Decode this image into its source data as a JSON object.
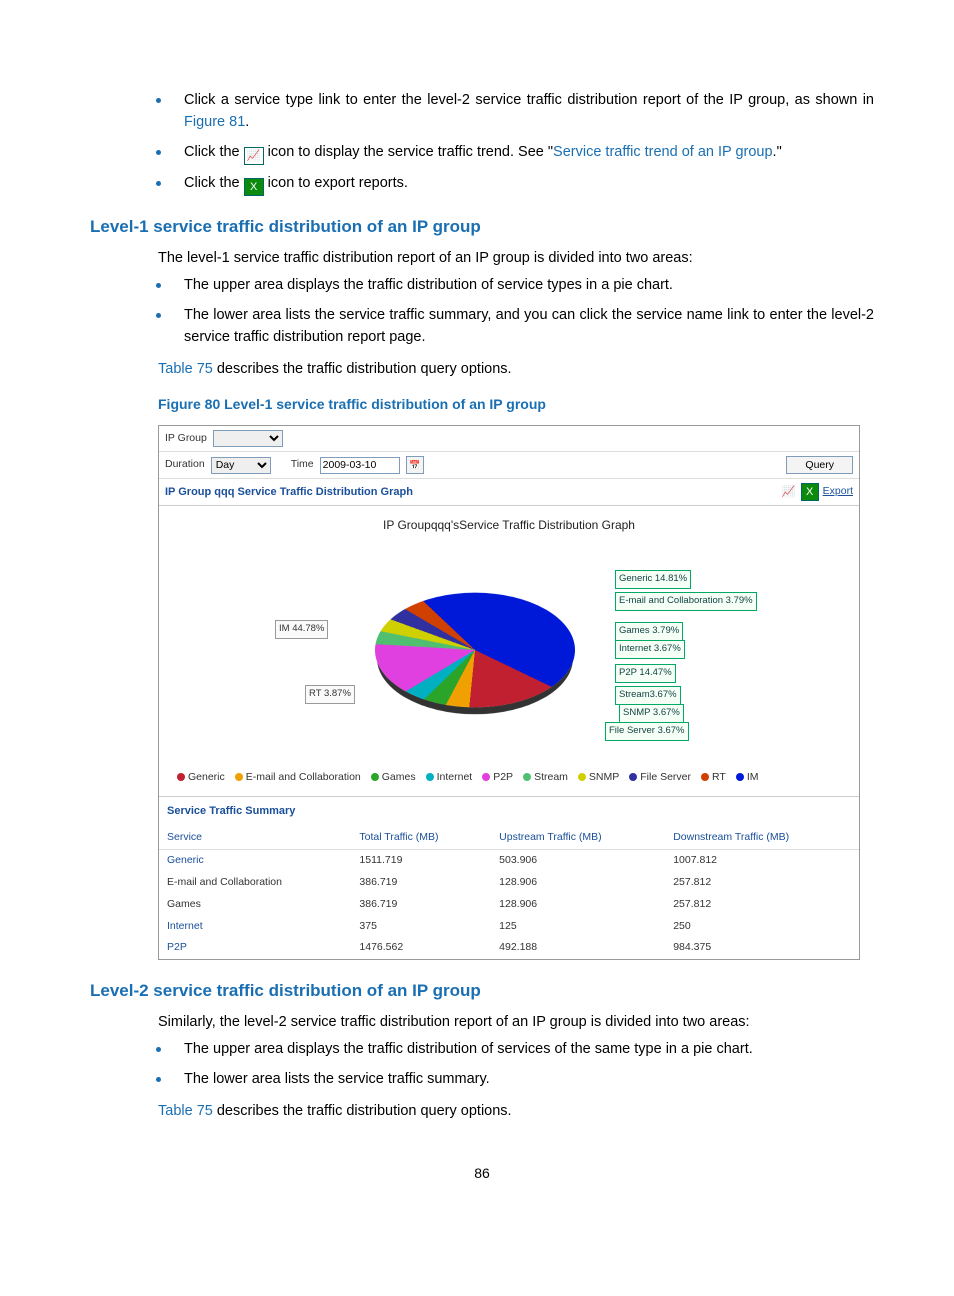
{
  "top_bullets": [
    {
      "pre": "Click a service type link to enter the level-2 service traffic distribution report of the IP group, as shown in ",
      "link": "Figure 81",
      "post": "."
    },
    {
      "pre": "Click the ",
      "icon": "trend",
      "mid": " icon to display the service traffic trend. See \"",
      "link": "Service traffic trend of an IP group",
      "post": ".\""
    },
    {
      "pre": "Click the ",
      "icon": "excel",
      "mid": " icon to export reports.",
      "link": "",
      "post": ""
    }
  ],
  "sec1": {
    "title": "Level-1 service traffic distribution of an IP group",
    "intro": "The level-1 service traffic distribution report of an IP group is divided into two areas:",
    "b1": "The upper area displays the traffic distribution of service types in a pie chart.",
    "b2": "The lower area lists the service traffic summary, and you can click the service name link to enter the level-2 service traffic distribution report page.",
    "ref_link": "Table 75",
    "ref_post": " describes the traffic distribution query options.",
    "figcap": "Figure 80 Level-1 service traffic distribution of an IP group"
  },
  "shot": {
    "labels": {
      "ipgroup": "IP Group",
      "duration": "Duration",
      "time": "Time",
      "query": "Query",
      "export": "Export"
    },
    "values": {
      "duration": "Day",
      "date": "2009-03-10"
    },
    "graph_header": "IP Group qqq Service Traffic Distribution Graph",
    "chart_title": "IP Groupqqq'sService Traffic Distribution Graph",
    "callouts": {
      "im": "IM    44.78%",
      "rt": "RT   3.87%",
      "c0": "Generic 14.81%",
      "c1": "E-mail and Collaboration 3.79%",
      "c2": "Games 3.79%",
      "c3": "Internet 3.67%",
      "c4": "P2P 14.47%",
      "c5": "Stream3.67%",
      "c6": "SNMP  3.67%",
      "c7": "File Server 3.67%"
    },
    "legend": [
      {
        "color": "#c02030",
        "label": "Generic"
      },
      {
        "color": "#f0a000",
        "label": "E-mail and Collaboration"
      },
      {
        "color": "#2aa52a",
        "label": "Games"
      },
      {
        "color": "#00b0c0",
        "label": "Internet"
      },
      {
        "color": "#e040e0",
        "label": "P2P"
      },
      {
        "color": "#50c070",
        "label": "Stream"
      },
      {
        "color": "#d0d000",
        "label": "SNMP"
      },
      {
        "color": "#3030a0",
        "label": "File Server"
      },
      {
        "color": "#d04000",
        "label": "RT"
      },
      {
        "color": "#0018d8",
        "label": "IM"
      }
    ],
    "summary_title": "Service Traffic Summary",
    "cols": [
      "Service",
      "Total Traffic (MB)",
      "Upstream Traffic (MB)",
      "Downstream Traffic (MB)"
    ],
    "rows": [
      {
        "svc": "Generic",
        "link": true,
        "t": "1511.719",
        "u": "503.906",
        "d": "1007.812"
      },
      {
        "svc": "E-mail and Collaboration",
        "link": false,
        "t": "386.719",
        "u": "128.906",
        "d": "257.812"
      },
      {
        "svc": "Games",
        "link": false,
        "t": "386.719",
        "u": "128.906",
        "d": "257.812"
      },
      {
        "svc": "Internet",
        "link": true,
        "t": "375",
        "u": "125",
        "d": "250"
      },
      {
        "svc": "P2P",
        "link": true,
        "t": "1476.562",
        "u": "492.188",
        "d": "984.375"
      }
    ]
  },
  "chart_data": {
    "type": "pie",
    "title": "IP Groupqqq'sService Traffic Distribution Graph",
    "series": [
      {
        "name": "Generic",
        "value": 14.81,
        "color": "#c02030"
      },
      {
        "name": "E-mail and Collaboration",
        "value": 3.79,
        "color": "#f0a000"
      },
      {
        "name": "Games",
        "value": 3.79,
        "color": "#2aa52a"
      },
      {
        "name": "Internet",
        "value": 3.67,
        "color": "#00b0c0"
      },
      {
        "name": "P2P",
        "value": 14.47,
        "color": "#e040e0"
      },
      {
        "name": "Stream",
        "value": 3.67,
        "color": "#50c070"
      },
      {
        "name": "SNMP",
        "value": 3.67,
        "color": "#d0d000"
      },
      {
        "name": "File Server",
        "value": 3.67,
        "color": "#3030a0"
      },
      {
        "name": "RT",
        "value": 3.87,
        "color": "#d04000"
      },
      {
        "name": "IM",
        "value": 44.78,
        "color": "#0018d8"
      }
    ],
    "table": {
      "columns": [
        "Service",
        "Total Traffic (MB)",
        "Upstream Traffic (MB)",
        "Downstream Traffic (MB)"
      ],
      "rows": [
        [
          "Generic",
          1511.719,
          503.906,
          1007.812
        ],
        [
          "E-mail and Collaboration",
          386.719,
          128.906,
          257.812
        ],
        [
          "Games",
          386.719,
          128.906,
          257.812
        ],
        [
          "Internet",
          375,
          125,
          250
        ],
        [
          "P2P",
          1476.562,
          492.188,
          984.375
        ]
      ]
    }
  },
  "sec2": {
    "title": "Level-2 service traffic distribution of an IP group",
    "intro": "Similarly, the level-2 service traffic distribution report of an IP group is divided into two areas:",
    "b1": "The upper area displays the traffic distribution of services of the same type in a pie chart.",
    "b2": "The lower area lists the service traffic summary.",
    "ref_link": "Table 75",
    "ref_post": " describes the traffic distribution query options."
  },
  "pagenum": "86"
}
